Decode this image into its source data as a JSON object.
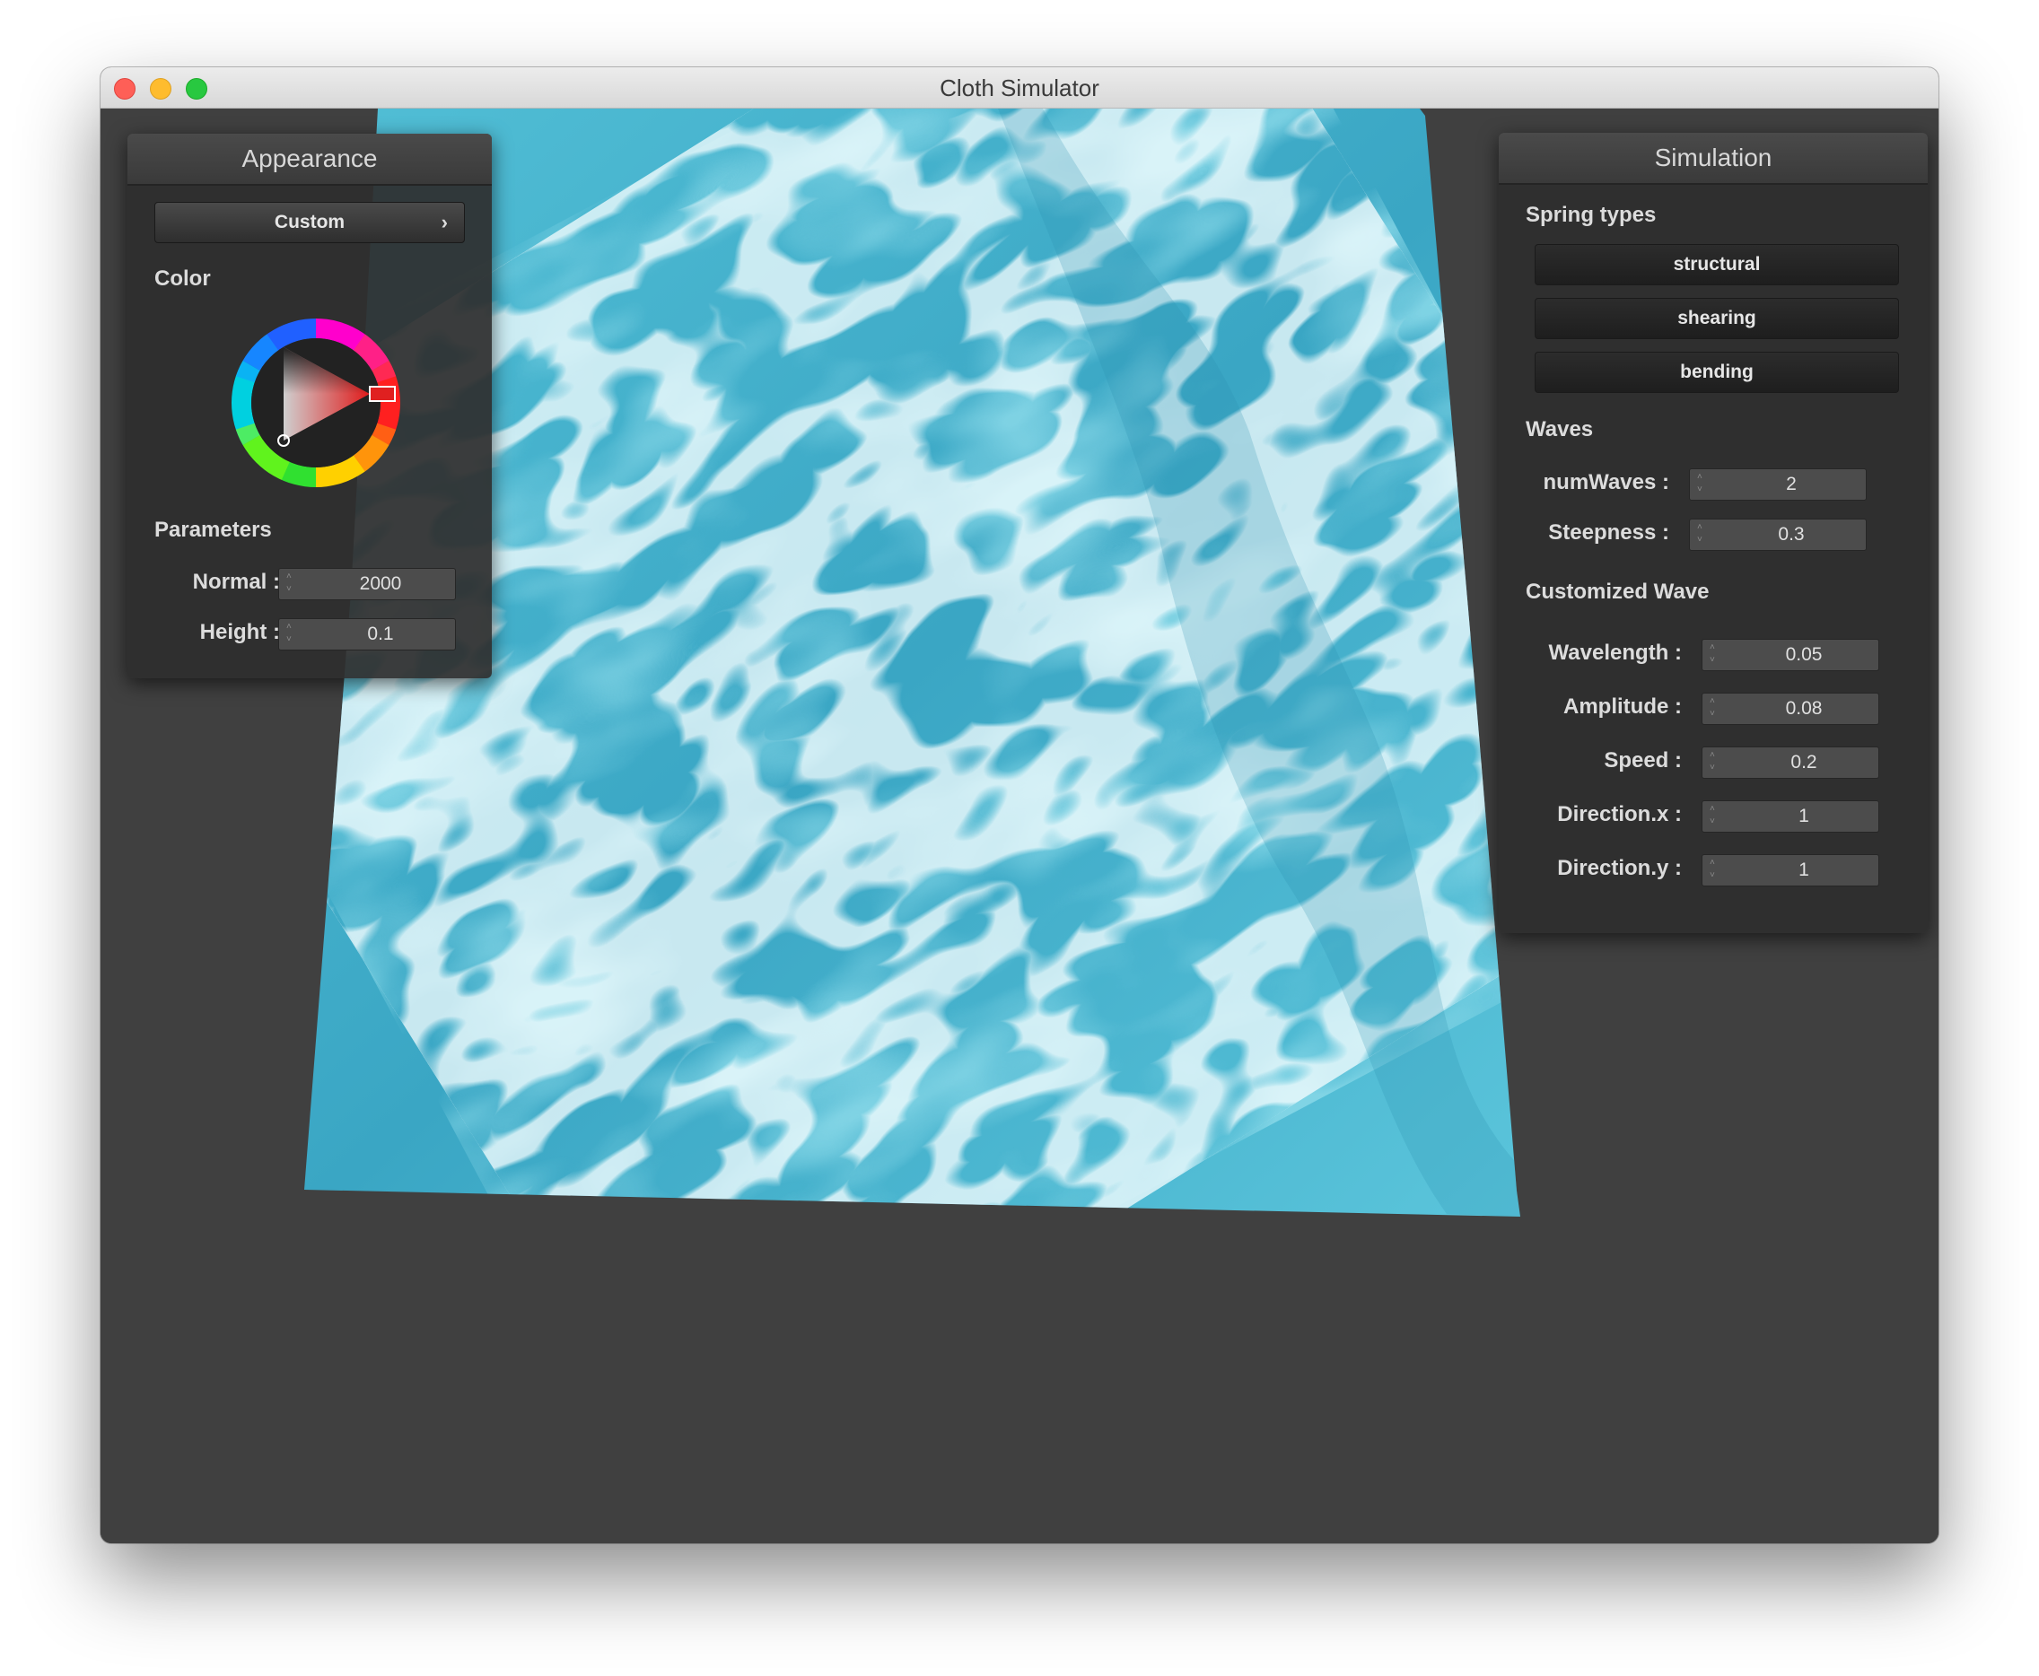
{
  "window": {
    "title": "Cloth Simulator"
  },
  "appearance": {
    "title": "Appearance",
    "preset": "Custom",
    "preset_chevron": "›",
    "color_label": "Color",
    "color_value": "#d02020",
    "parameters_label": "Parameters",
    "normal": {
      "label": "Normal :",
      "value": "2000"
    },
    "height": {
      "label": "Height :",
      "value": "0.1"
    }
  },
  "simulation": {
    "title": "Simulation",
    "spring_types_label": "Spring types",
    "spring_buttons": [
      "structural",
      "shearing",
      "bending"
    ],
    "waves_label": "Waves",
    "num_waves": {
      "label": "numWaves :",
      "value": "2"
    },
    "steepness": {
      "label": "Steepness :",
      "value": "0.3"
    },
    "custom_wave_label": "Customized Wave",
    "wavelength": {
      "label": "Wavelength :",
      "value": "0.05"
    },
    "amplitude": {
      "label": "Amplitude :",
      "value": "0.08"
    },
    "speed": {
      "label": "Speed :",
      "value": "0.2"
    },
    "direction_x": {
      "label": "Direction.x :",
      "value": "1"
    },
    "direction_y": {
      "label": "Direction.y :",
      "value": "1"
    }
  },
  "colors": {
    "water_base": "#49b3cc",
    "water_highlight": "#e8fbff",
    "water_deep": "#2489a6",
    "background": "#404040"
  }
}
